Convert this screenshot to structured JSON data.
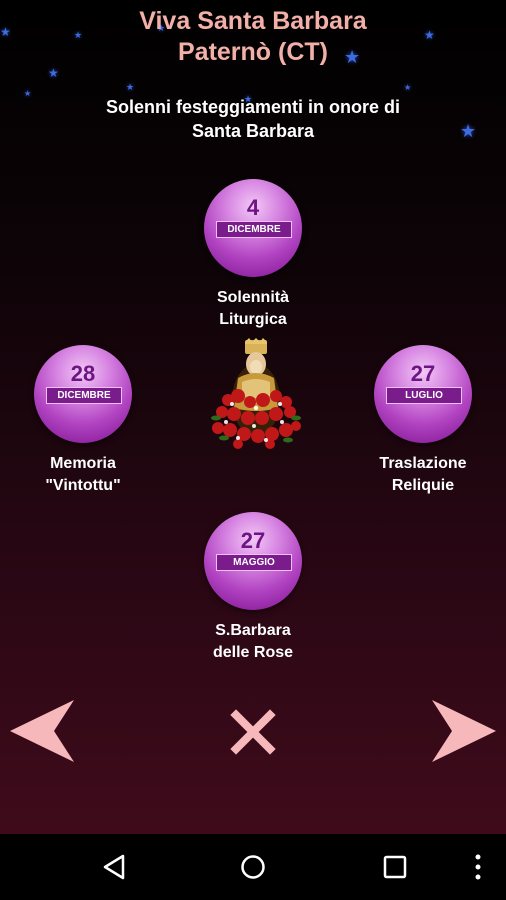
{
  "header": {
    "title_line1": "Viva Santa Barbara",
    "title_line2": "Paternò (CT)"
  },
  "subtitle": {
    "line1": "Solenni festeggiamenti in onore di",
    "line2": "Santa Barbara"
  },
  "events": {
    "top": {
      "day": "4",
      "month": "DICEMBRE",
      "label_line1": "Solennità",
      "label_line2": "Liturgica"
    },
    "left": {
      "day": "28",
      "month": "DICEMBRE",
      "label_line1": "Memoria",
      "label_line2": "\"Vintottu\""
    },
    "right": {
      "day": "27",
      "month": "LUGLIO",
      "label_line1": "Traslazione",
      "label_line2": "Reliquie"
    },
    "bottom": {
      "day": "27",
      "month": "MAGGIO",
      "label_line1": "S.Barbara",
      "label_line2": "delle Rose"
    }
  },
  "icons": {
    "prev": "arrow-left-icon",
    "close": "close-icon",
    "next": "arrow-right-icon",
    "statue": "santa-barbara-statue-image",
    "back": "back-icon",
    "home": "home-icon",
    "recents": "recents-icon",
    "overflow": "overflow-menu-icon",
    "star": "star-icon"
  },
  "colors": {
    "title": "#f3b0a8",
    "nav_arrows": "#f7b8bb",
    "circle": "#b244c2",
    "star": "#3d6be0"
  }
}
